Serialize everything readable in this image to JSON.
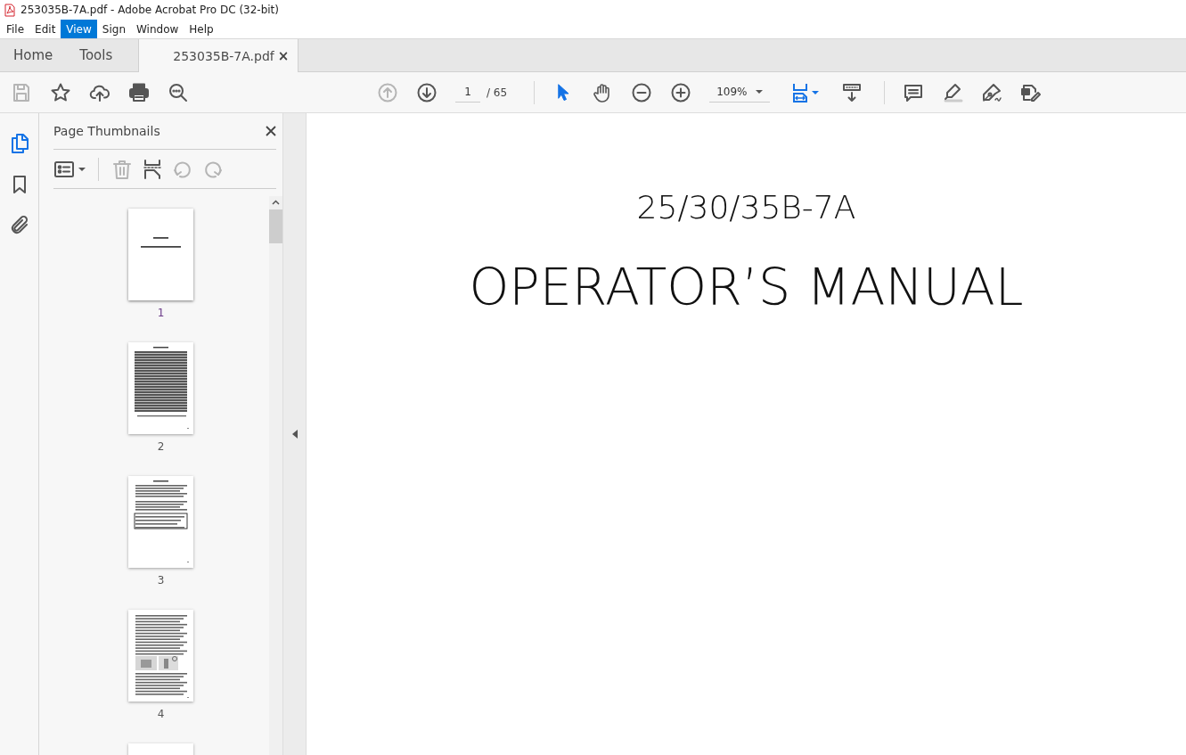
{
  "window": {
    "title": "253035B-7A.pdf - Adobe Acrobat Pro DC (32-bit)"
  },
  "menu": [
    {
      "label": "File",
      "selected": false
    },
    {
      "label": "Edit",
      "selected": false
    },
    {
      "label": "View",
      "selected": true
    },
    {
      "label": "Sign",
      "selected": false
    },
    {
      "label": "Window",
      "selected": false
    },
    {
      "label": "Help",
      "selected": false
    }
  ],
  "tabs": [
    {
      "label": "Home",
      "kind": "nav",
      "selected": false
    },
    {
      "label": "Tools",
      "kind": "nav",
      "selected": false
    },
    {
      "label": "253035B-7A.pdf",
      "kind": "document",
      "selected": true,
      "close": "×"
    }
  ],
  "toolbar": {
    "left_tools": [
      {
        "kind": "save",
        "disabled": true
      },
      {
        "kind": "star",
        "disabled": false
      },
      {
        "kind": "upload",
        "disabled": false
      },
      {
        "kind": "print",
        "disabled": false
      },
      {
        "kind": "search",
        "disabled": false
      }
    ],
    "nav_tools": [
      {
        "kind": "prev",
        "disabled": true
      },
      {
        "kind": "next",
        "disabled": false
      }
    ],
    "page": {
      "value": "1",
      "total": "/ 65"
    },
    "view_tools": [
      {
        "kind": "pointer",
        "selected": true
      },
      {
        "kind": "hand",
        "selected": false
      },
      {
        "kind": "zoom_out",
        "selected": false
      },
      {
        "kind": "zoom_in",
        "selected": false
      }
    ],
    "zoom": {
      "value": "109%"
    },
    "fit_tools": [
      {
        "kind": "fit"
      },
      {
        "kind": "scroll"
      }
    ],
    "right_tools": [
      {
        "kind": "comment"
      },
      {
        "kind": "highlight"
      },
      {
        "kind": "sign"
      },
      {
        "kind": "edit"
      }
    ]
  },
  "rail": [
    {
      "kind": "pages",
      "selected": true
    },
    {
      "kind": "bookmarks",
      "selected": false
    },
    {
      "kind": "attachments",
      "selected": false
    }
  ],
  "panel": {
    "title": "Page Thumbnails",
    "tools": [
      {
        "kind": "options",
        "disabled": false
      },
      {
        "kind": "delete",
        "disabled": true
      },
      {
        "kind": "extract",
        "disabled": false
      },
      {
        "kind": "rotate_left",
        "disabled": true
      },
      {
        "kind": "rotate_right",
        "disabled": true
      }
    ],
    "thumbnails": [
      {
        "label": "1",
        "kind": "cover",
        "selected": true
      },
      {
        "label": "2",
        "kind": "table",
        "selected": false
      },
      {
        "label": "3",
        "kind": "text_table",
        "selected": false
      },
      {
        "label": "4",
        "kind": "text_figure",
        "selected": false
      },
      {
        "kind": "partial",
        "selected": false
      }
    ]
  },
  "document": {
    "heading": "25/30/35B-7A",
    "title": "OPERATOR’S MANUAL"
  }
}
